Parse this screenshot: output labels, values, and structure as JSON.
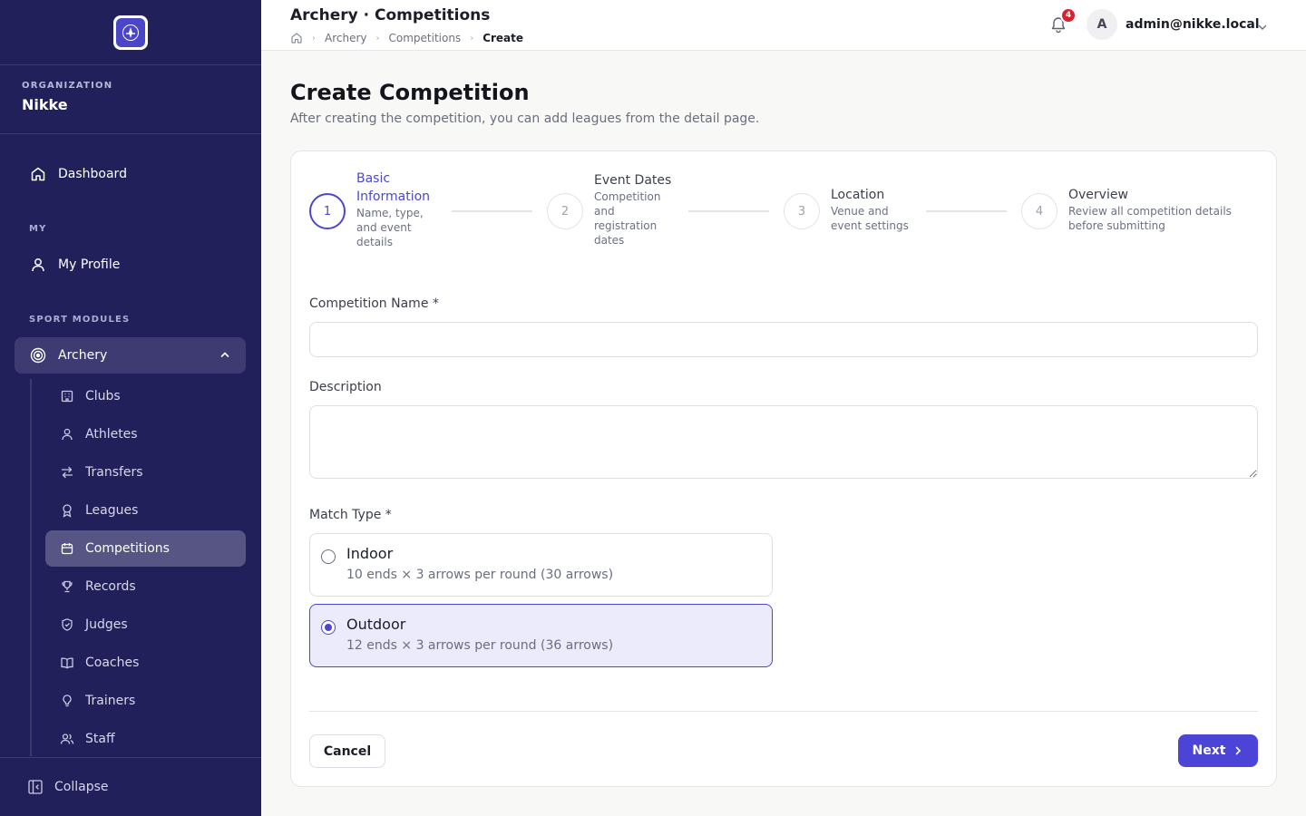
{
  "sidebar": {
    "org_label": "ORGANIZATION",
    "org_name": "Nikke",
    "dashboard": "Dashboard",
    "my_label": "MY",
    "my_profile": "My Profile",
    "sport_modules_label": "SPORT MODULES",
    "archery": "Archery",
    "sub_items": [
      "Clubs",
      "Athletes",
      "Transfers",
      "Leagues",
      "Competitions",
      "Records",
      "Judges",
      "Coaches",
      "Trainers",
      "Staff"
    ],
    "active_sub_item": "Competitions",
    "collapse": "Collapse"
  },
  "header": {
    "title": "Archery · Competitions",
    "breadcrumb": [
      "Archery",
      "Competitions",
      "Create"
    ],
    "notification_count": "4",
    "avatar_initial": "A",
    "user_email": "admin@nikke.local"
  },
  "page": {
    "title": "Create Competition",
    "subtitle": "After creating the competition, you can add leagues from the detail page."
  },
  "steps": [
    {
      "number": "1",
      "title": "Basic Information",
      "desc": "Name, type, and event details",
      "active": true
    },
    {
      "number": "2",
      "title": "Event Dates",
      "desc": "Competition and registration dates",
      "active": false
    },
    {
      "number": "3",
      "title": "Location",
      "desc": "Venue and event settings",
      "active": false
    },
    {
      "number": "4",
      "title": "Overview",
      "desc": "Review all competition details before submitting",
      "active": false
    }
  ],
  "form": {
    "competition_name_label": "Competition Name *",
    "competition_name_value": "",
    "description_label": "Description",
    "description_value": "",
    "match_type_label": "Match Type *",
    "options": [
      {
        "title": "Indoor",
        "desc": "10 ends × 3 arrows per round (30 arrows)",
        "selected": false
      },
      {
        "title": "Outdoor",
        "desc": "12 ends × 3 arrows per round (36 arrows)",
        "selected": true
      }
    ]
  },
  "actions": {
    "cancel": "Cancel",
    "next": "Next"
  },
  "colors": {
    "sidebar_bg": "#22205a",
    "accent": "#4c47cf",
    "badge": "#d6232f"
  }
}
